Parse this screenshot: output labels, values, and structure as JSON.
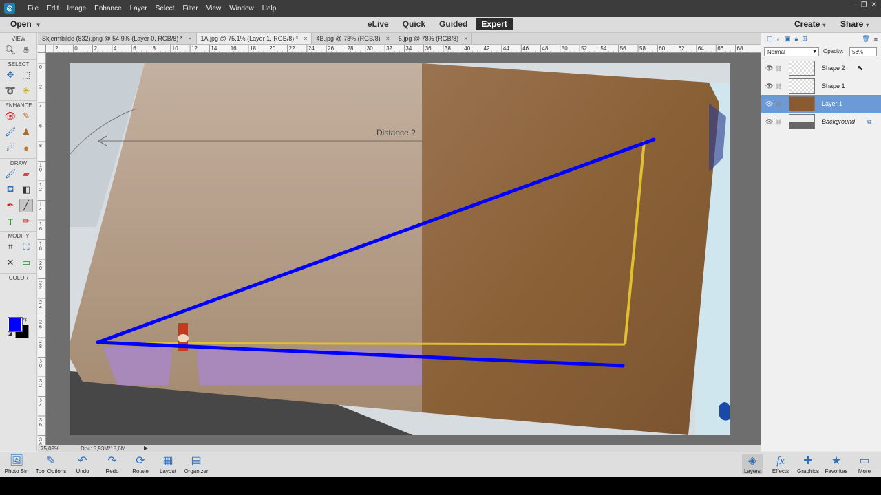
{
  "menubar": {
    "logo": "elements-logo",
    "items": [
      "File",
      "Edit",
      "Image",
      "Enhance",
      "Layer",
      "Select",
      "Filter",
      "View",
      "Window",
      "Help"
    ],
    "window_controls": [
      "–",
      "❐",
      "✕"
    ]
  },
  "modebar": {
    "open_label": "Open",
    "modes": [
      "eLive",
      "Quick",
      "Guided",
      "Expert"
    ],
    "active_mode": "Expert",
    "create_label": "Create",
    "share_label": "Share"
  },
  "toolbox": {
    "sections": [
      "VIEW",
      "SELECT",
      "ENHANCE",
      "DRAW",
      "MODIFY",
      "COLOR"
    ],
    "foreground_color": "#0000ff",
    "background_color": "#000000"
  },
  "tabs": [
    {
      "label": "Skjermbilde (832).png @ 54,9% (Layer 0, RGB/8) *"
    },
    {
      "label": "1A.jpg @ 75,1% (Layer 1, RGB/8) *"
    },
    {
      "label": "4B.jpg @ 78% (RGB/8)"
    },
    {
      "label": "5.jpg @ 78% (RGB/8)"
    }
  ],
  "active_tab": 1,
  "rulers": {
    "h_ticks": [
      "2",
      "0",
      "2",
      "4",
      "6",
      "8",
      "10",
      "12",
      "14",
      "16",
      "18",
      "20",
      "22",
      "24",
      "26",
      "28",
      "30",
      "32",
      "34",
      "36",
      "38",
      "40",
      "42",
      "44",
      "46",
      "48",
      "50",
      "52",
      "54",
      "56",
      "58",
      "60",
      "62",
      "64",
      "66",
      "68"
    ],
    "v_ticks": [
      "0",
      "2",
      "4",
      "6",
      "8",
      "10",
      "12",
      "14",
      "16",
      "18",
      "20",
      "22",
      "24",
      "26",
      "28",
      "30",
      "32",
      "34",
      "36",
      "38"
    ]
  },
  "canvas": {
    "annotation_text": "Distance ?",
    "line_color": "#0000ff"
  },
  "status": {
    "zoom": "75,09%",
    "doc": "Doc: 5,93M/18,6M"
  },
  "layers_panel": {
    "blend_mode": "Normal",
    "opacity_label": "Opacity:",
    "opacity_value": "58%",
    "layers": [
      {
        "name": "Shape 2",
        "active": false
      },
      {
        "name": "Shape 1",
        "active": false
      },
      {
        "name": "Layer 1",
        "active": true
      },
      {
        "name": "Background",
        "active": false
      }
    ]
  },
  "bottombar": {
    "left": [
      {
        "label": "Photo Bin",
        "icon": "photo-bin-icon"
      },
      {
        "label": "Tool Options",
        "icon": "tool-options-icon"
      },
      {
        "label": "Undo",
        "icon": "undo-icon"
      },
      {
        "label": "Redo",
        "icon": "redo-icon"
      },
      {
        "label": "Rotate",
        "icon": "rotate-icon"
      },
      {
        "label": "Layout",
        "icon": "layout-icon"
      },
      {
        "label": "Organizer",
        "icon": "organizer-icon"
      }
    ],
    "right": [
      {
        "label": "Layers",
        "icon": "layers-icon"
      },
      {
        "label": "Effects",
        "icon": "effects-icon"
      },
      {
        "label": "Graphics",
        "icon": "graphics-icon"
      },
      {
        "label": "Favorites",
        "icon": "favorites-icon"
      },
      {
        "label": "More",
        "icon": "more-icon"
      }
    ]
  }
}
